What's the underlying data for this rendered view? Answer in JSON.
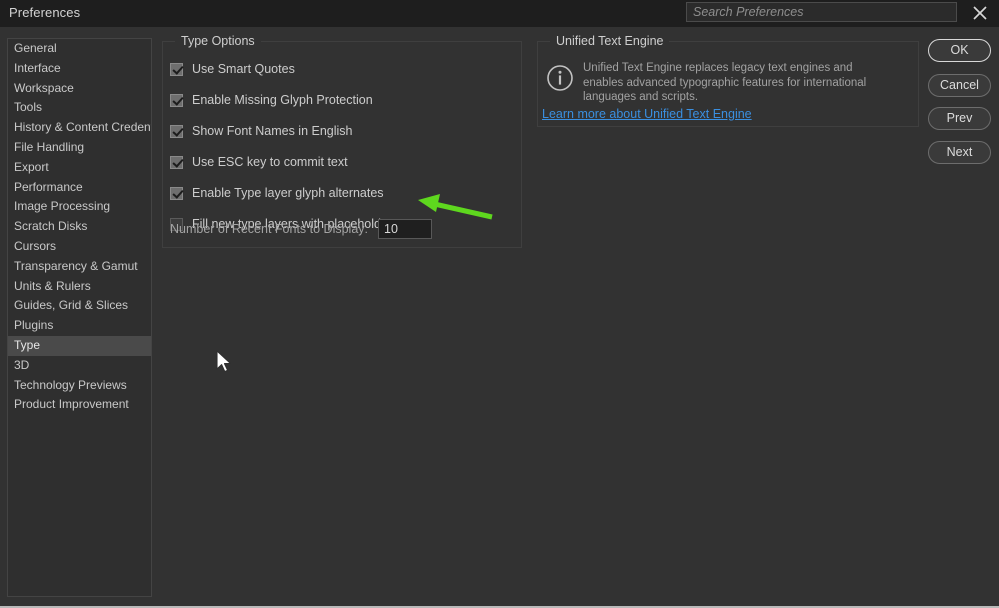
{
  "window": {
    "title": "Preferences"
  },
  "search": {
    "placeholder": "Search Preferences",
    "value": "",
    "close_icon": "close-icon"
  },
  "sidebar": {
    "items": [
      {
        "label": "General",
        "selected": false
      },
      {
        "label": "Interface",
        "selected": false
      },
      {
        "label": "Workspace",
        "selected": false
      },
      {
        "label": "Tools",
        "selected": false
      },
      {
        "label": "History & Content Credentials",
        "selected": false
      },
      {
        "label": "File Handling",
        "selected": false
      },
      {
        "label": "Export",
        "selected": false
      },
      {
        "label": "Performance",
        "selected": false
      },
      {
        "label": "Image Processing",
        "selected": false
      },
      {
        "label": "Scratch Disks",
        "selected": false
      },
      {
        "label": "Cursors",
        "selected": false
      },
      {
        "label": "Transparency & Gamut",
        "selected": false
      },
      {
        "label": "Units & Rulers",
        "selected": false
      },
      {
        "label": "Guides, Grid & Slices",
        "selected": false
      },
      {
        "label": "Plugins",
        "selected": false
      },
      {
        "label": "Type",
        "selected": true
      },
      {
        "label": "3D",
        "selected": false
      },
      {
        "label": "Technology Previews",
        "selected": false
      },
      {
        "label": "Product Improvement",
        "selected": false
      }
    ]
  },
  "type_options": {
    "group_title": "Type Options",
    "checkboxes": [
      {
        "label": "Use Smart Quotes",
        "checked": true
      },
      {
        "label": "Enable Missing Glyph Protection",
        "checked": true
      },
      {
        "label": "Show Font Names in English",
        "checked": true
      },
      {
        "label": "Use ESC key to commit text",
        "checked": true
      },
      {
        "label": "Enable Type layer glyph alternates",
        "checked": true
      },
      {
        "label": "Fill new type layers with placeholder text",
        "checked": false
      }
    ],
    "recent_fonts": {
      "label": "Number of Recent Fonts to Display:",
      "value": "10"
    }
  },
  "unified_text_engine": {
    "group_title": "Unified Text Engine",
    "info_icon": "info-circle-icon",
    "description": "Unified Text Engine replaces legacy text engines and enables advanced typographic features for international languages and scripts.",
    "link_label": "Learn more about Unified Text Engine"
  },
  "buttons": {
    "ok": "OK",
    "cancel": "Cancel",
    "prev": "Prev",
    "next": "Next"
  },
  "annotation": {
    "arrow_color": "#5ed71e",
    "points_to": "Fill new type layers with placeholder text"
  },
  "colors": {
    "window_bg": "#323232",
    "titlebar_bg": "#1e1e1e",
    "sidebar_bg": "#2f2f2f",
    "selected_bg": "#4a4a4a",
    "link": "#3a8fe0",
    "text": "#cdcdcd",
    "muted_text": "#a2a2a2",
    "annotation_green": "#5ed71e"
  }
}
